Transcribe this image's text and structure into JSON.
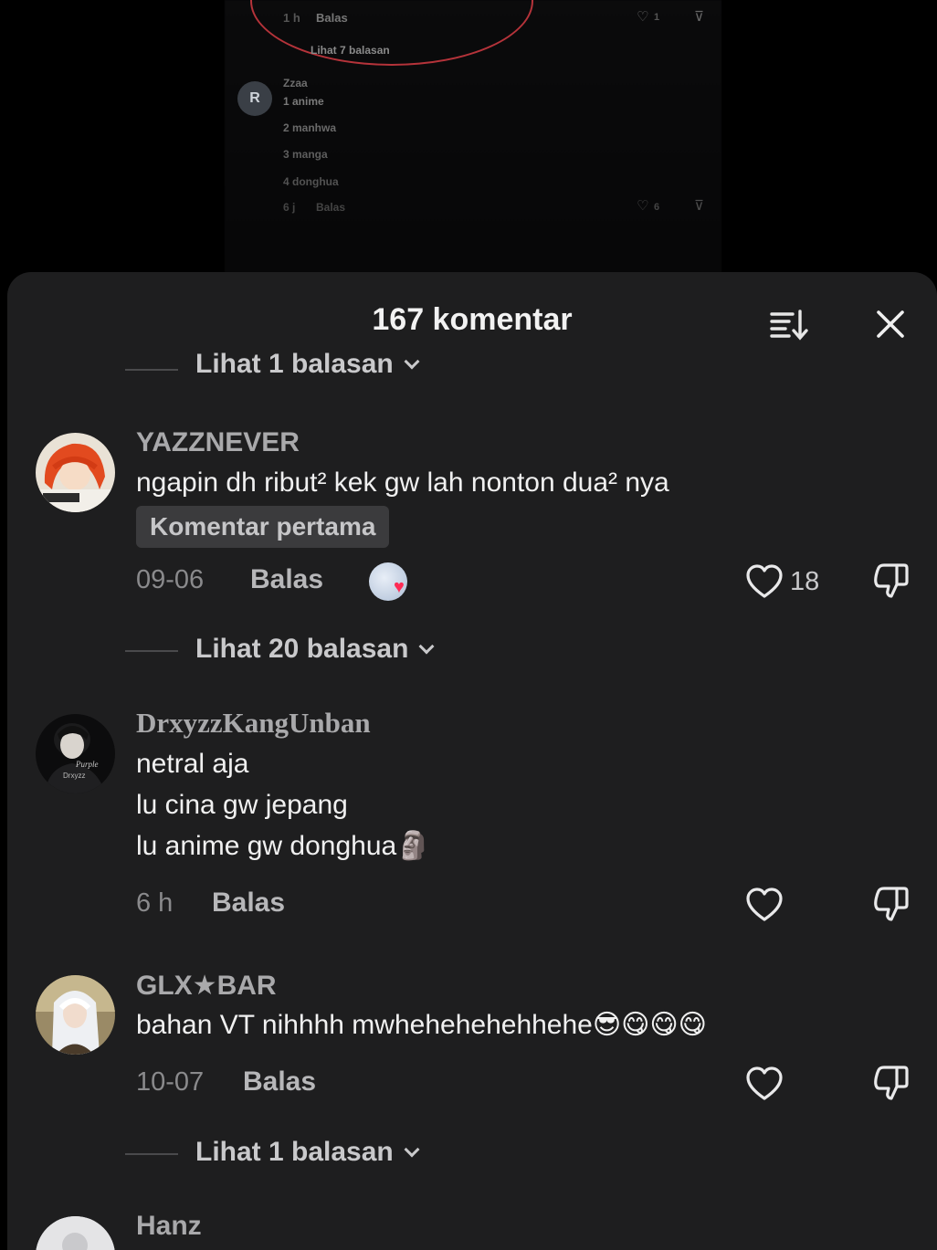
{
  "video": {
    "reply_time": "1 h",
    "reply_label": "Balas",
    "like_count": "1",
    "see_replies": "Lihat 7 balasan",
    "avatar_letter": "R",
    "user": "Zzaa",
    "lines": [
      "1 anime",
      "2 manhwa",
      "3 manga",
      "4 donghua"
    ],
    "bottom_time": "6 j",
    "bottom_reply": "Balas",
    "bottom_like": "6"
  },
  "sheet": {
    "title": "167 komentar"
  },
  "partial_replies": "Lihat 1 balasan",
  "comments": [
    {
      "username": "YAZZNEVER",
      "text": "ngapin dh ribut² kek gw lah nonton dua² nya",
      "badge": "Komentar pertama",
      "time": "09-06",
      "reply_label": "Balas",
      "like_count": "18",
      "replies": "Lihat 20 balasan"
    },
    {
      "username": "DrxyzzKangUnban",
      "lines": [
        "netral aja",
        "lu cina gw jepang",
        "lu anime gw donghua🗿"
      ],
      "time": "6 h",
      "reply_label": "Balas",
      "like_count": ""
    },
    {
      "username": "GLX★BAR",
      "text": "bahan VT nihhhh mwhehehehehhehe😎😋😋😋",
      "time": "10-07",
      "reply_label": "Balas",
      "like_count": "",
      "replies": "Lihat 1 balasan"
    },
    {
      "username": "Hanz"
    }
  ],
  "colors": {
    "sheet_bg": "#1e1e1f",
    "username": "#a9a9ab",
    "text": "#f0f0f0",
    "meta": "#8a8a8c",
    "highlight_circle": "#b5333a"
  },
  "icons": [
    "sort-icon",
    "close-icon",
    "heart-outline-icon",
    "dislike-icon",
    "chevron-down-icon"
  ]
}
